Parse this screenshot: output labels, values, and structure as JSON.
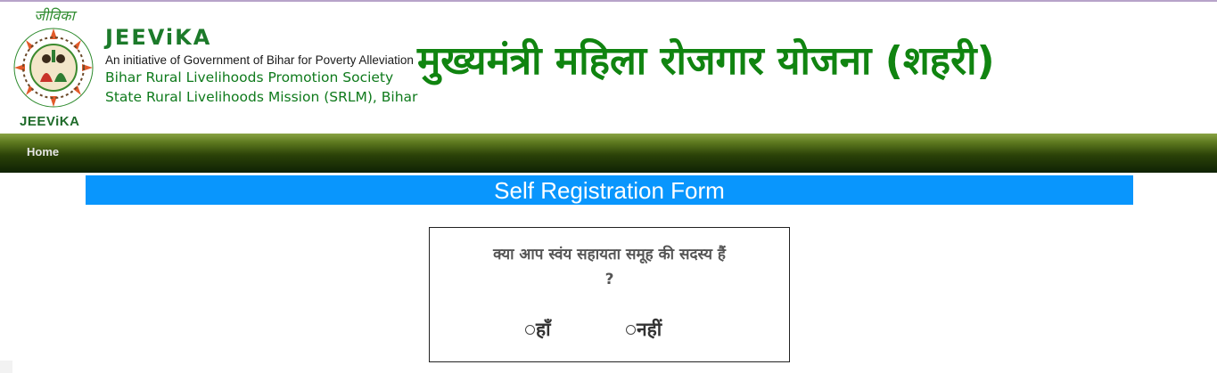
{
  "header": {
    "logo": {
      "top_text": "जीविका",
      "bottom_text": "JEEViKA",
      "icon": "jeevika-logo-icon"
    },
    "brand": "JEEViKA",
    "tagline": "An initiative of Government of Bihar for Poverty Alleviation",
    "org_line1": "Bihar Rural Livelihoods Promotion Society",
    "org_line2": "State Rural Livelihoods Mission (SRLM), Bihar",
    "scheme_title": "मुख्यमंत्री महिला रोजगार योजना (शहरी)"
  },
  "nav": {
    "items": [
      {
        "label": "Home"
      }
    ]
  },
  "form": {
    "title": "Self Registration Form",
    "question_line1": "क्या आप स्वंय सहायता समूह की सदस्य हैं",
    "question_line2": "?",
    "options": [
      {
        "label": "हाँ",
        "selected": false
      },
      {
        "label": "नहीं",
        "selected": false
      }
    ]
  },
  "colors": {
    "title_green": "#108410",
    "banner_blue": "#0996fd",
    "nav_dark": "#1a3306"
  }
}
